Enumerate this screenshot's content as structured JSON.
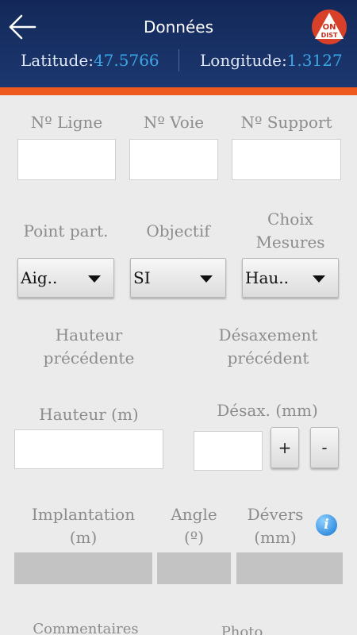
{
  "header": {
    "title": "Données",
    "latitude_label": "Latitude:",
    "latitude_value": "47.5766",
    "longitude_label": "Longitude:",
    "longitude_value": "1.3127",
    "logo_line1": "ON",
    "logo_line2": "DIST",
    "colors": {
      "bg": "#132858",
      "accent": "#ee5a1e",
      "coord_value": "#3aa6e6"
    }
  },
  "row1": {
    "ligne_label": "Nº Ligne",
    "voie_label": "Nº Voie",
    "support_label": "Nº Support"
  },
  "row2": {
    "point_label": "Point part.",
    "objectif_label": "Objectif",
    "choix_line1": "Choix",
    "choix_line2": "Mesures",
    "point_value": "Aig..",
    "objectif_value": "SI",
    "choix_value": "Hau.."
  },
  "row3": {
    "hauteur_prec_line1": "Hauteur",
    "hauteur_prec_line2": "précédente",
    "desax_prec_line1": "Désaxement",
    "desax_prec_line2": "précédent"
  },
  "row4": {
    "hauteur_label": "Hauteur (m)",
    "desax_label": "Désax. (mm)",
    "plus": "+",
    "minus": "-"
  },
  "row5": {
    "implantation_line1": "Implantation",
    "implantation_line2": "(m)",
    "angle_line1": "Angle",
    "angle_line2": "(º)",
    "devers_line1": "Dévers",
    "devers_line2": "(mm)",
    "info_glyph": "i"
  },
  "row6": {
    "commentaires_label": "Commentaires",
    "photo_label": "Photo"
  }
}
